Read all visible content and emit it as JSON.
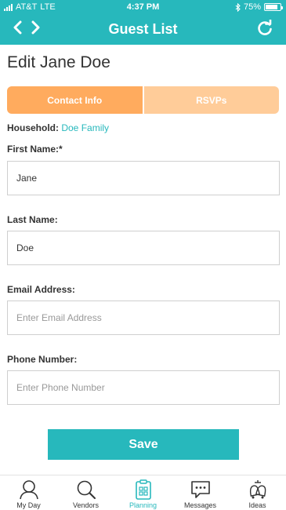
{
  "status_bar": {
    "carrier": "AT&T",
    "network": "LTE",
    "time": "4:37 PM",
    "battery": "75%",
    "battery_level": 0.75
  },
  "header": {
    "title": "Guest List",
    "back_icon": "chevron-left-icon",
    "forward_icon": "chevron-right-icon",
    "refresh_icon": "refresh-icon"
  },
  "page": {
    "title": "Edit Jane Doe"
  },
  "tabs": [
    {
      "label": "Contact Info",
      "active": true
    },
    {
      "label": "RSVPs",
      "active": false
    }
  ],
  "household": {
    "label": "Household:",
    "value": "Doe Family"
  },
  "form": {
    "first_name": {
      "label": "First Name:*",
      "value": "Jane",
      "placeholder": ""
    },
    "last_name": {
      "label": "Last Name:",
      "value": "Doe",
      "placeholder": ""
    },
    "email": {
      "label": "Email Address:",
      "value": "",
      "placeholder": "Enter Email Address"
    },
    "phone": {
      "label": "Phone Number:",
      "value": "",
      "placeholder": "Enter Phone Number"
    },
    "save_label": "Save"
  },
  "tab_bar": [
    {
      "label": "My Day",
      "icon": "person-icon",
      "active": false
    },
    {
      "label": "Vendors",
      "icon": "search-icon",
      "active": false
    },
    {
      "label": "Planning",
      "icon": "clipboard-icon",
      "active": true
    },
    {
      "label": "Messages",
      "icon": "chat-bubble-icon",
      "active": false
    },
    {
      "label": "Ideas",
      "icon": "bells-icon",
      "active": false
    }
  ],
  "colors": {
    "accent": "#27b8bc",
    "tab_active": "#ffab5e",
    "tab_inactive": "#ffcc99"
  }
}
